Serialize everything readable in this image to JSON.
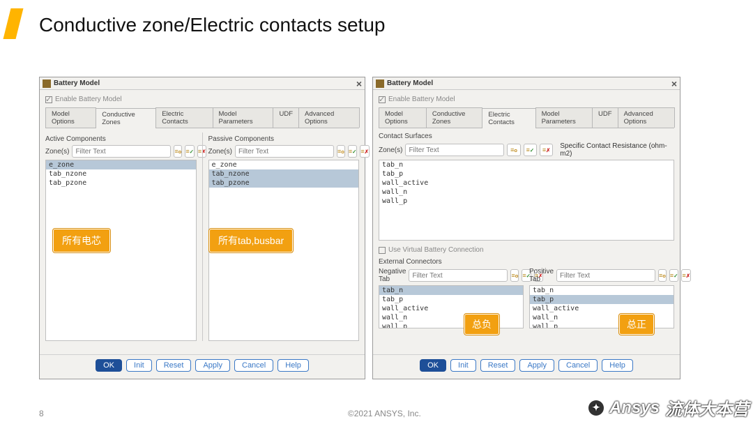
{
  "slide": {
    "title": "Conductive zone/Electric contacts setup",
    "page_number": "8",
    "copyright": "©2021 ANSYS, Inc.",
    "watermark_left": "Ansys",
    "watermark_right": "流体大本营"
  },
  "dialog": {
    "title": "Battery Model",
    "enable_label": "Enable Battery Model",
    "enable_checked": true,
    "tabs": [
      "Model Options",
      "Conductive Zones",
      "Electric Contacts",
      "Model Parameters",
      "UDF",
      "Advanced Options"
    ],
    "zones_label": "Zone(s)",
    "filter_placeholder": "Filter Text",
    "buttons": {
      "ok": "OK",
      "init": "Init",
      "reset": "Reset",
      "apply": "Apply",
      "cancel": "Cancel",
      "help": "Help"
    }
  },
  "conductive": {
    "active_tab": "Conductive Zones",
    "active_label": "Active Components",
    "passive_label": "Passive Components",
    "list": [
      "e_zone",
      "tab_nzone",
      "tab_pzone"
    ],
    "active_selected": [
      "e_zone"
    ],
    "passive_selected": [
      "tab_nzone",
      "tab_pzone"
    ],
    "callout_active": "所有电芯",
    "callout_passive": "所有tab,busbar"
  },
  "contacts": {
    "active_tab": "Electric Contacts",
    "surfaces_label": "Contact Surfaces",
    "specific_label": "Specific Contact Resistance (ohm-m2)",
    "surfaces_list": [
      "tab_n",
      "tab_p",
      "wall_active",
      "wall_n",
      "wall_p"
    ],
    "use_virtual_label": "Use Virtual Battery Connection",
    "external_label": "External Connectors",
    "neg_label": "Negative Tab",
    "pos_label": "Positive Tab",
    "ext_list": [
      "tab_n",
      "tab_p",
      "wall_active",
      "wall_n",
      "wall_p"
    ],
    "neg_selected": [
      "tab_n"
    ],
    "pos_selected": [
      "tab_p"
    ],
    "callout_neg": "总负",
    "callout_pos": "总正"
  }
}
